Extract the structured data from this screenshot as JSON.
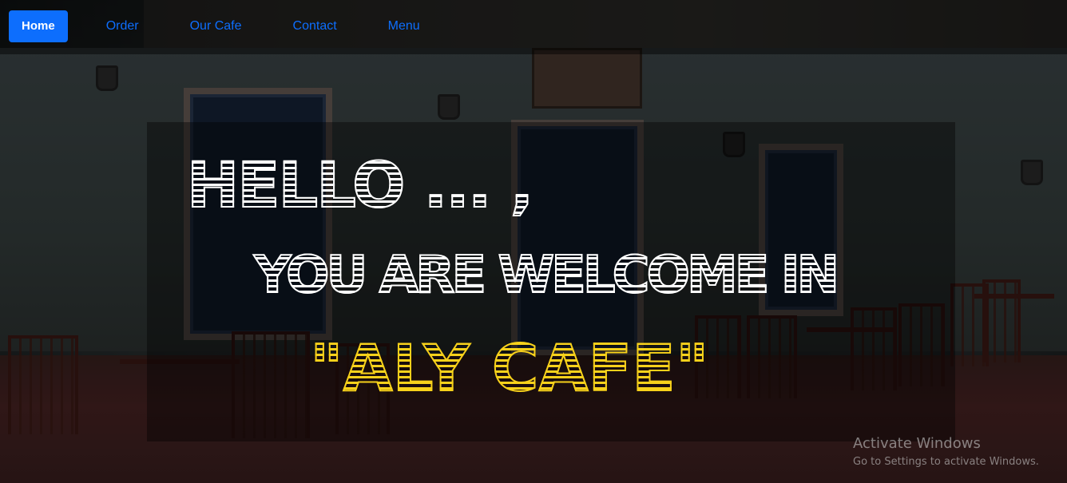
{
  "nav": {
    "items": [
      {
        "label": "Home",
        "active": true
      },
      {
        "label": "Order",
        "active": false
      },
      {
        "label": "Our Cafe",
        "active": false
      },
      {
        "label": "Contact",
        "active": false
      },
      {
        "label": "Menu",
        "active": false
      }
    ],
    "accent_color": "#0d6efd"
  },
  "hero": {
    "line1": "Hello ... ,",
    "line2": "You are welcome in",
    "line3": "\"ALY CAFE\"",
    "line3_color": "#f7d11b",
    "text_color": "#ffffff"
  },
  "watermark": {
    "title": "Activate Windows",
    "subtitle": "Go to Settings to activate Windows."
  }
}
